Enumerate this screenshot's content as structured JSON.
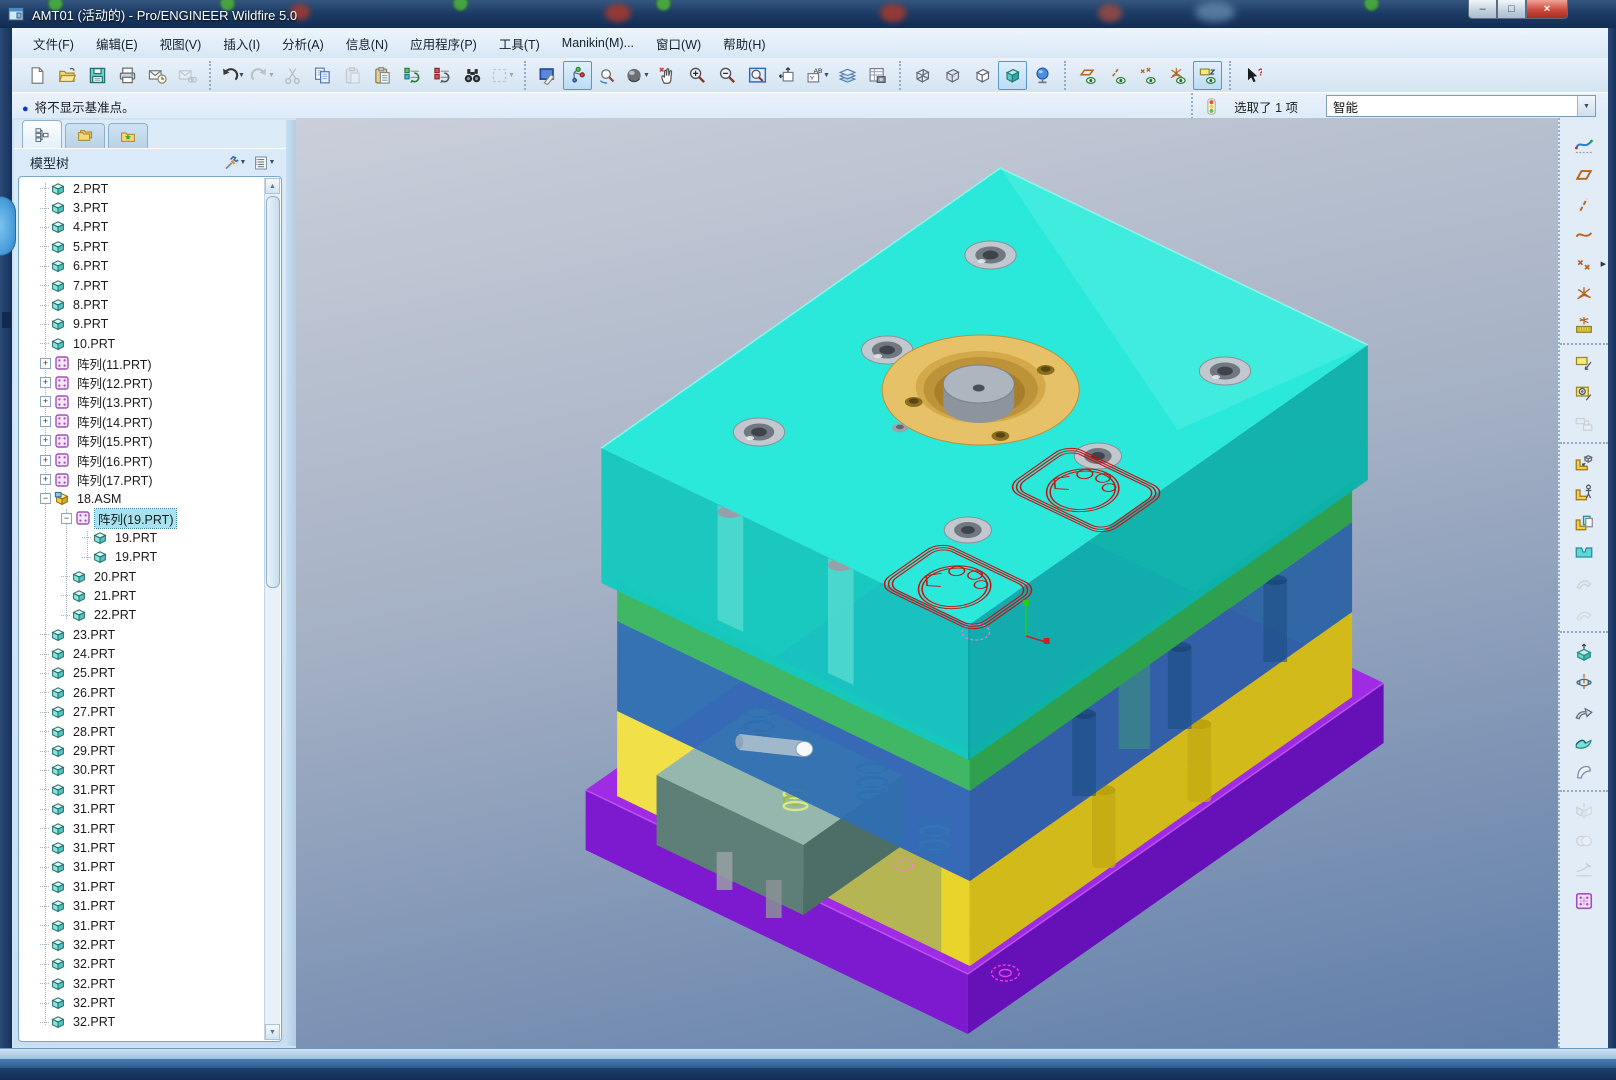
{
  "window": {
    "title": "AMT01 (活动的) - Pro/ENGINEER Wildfire 5.0",
    "controls": [
      {
        "name": "minimize",
        "glyph": "–"
      },
      {
        "name": "maximize",
        "glyph": "□"
      },
      {
        "name": "close",
        "glyph": "×"
      }
    ]
  },
  "menu_bar": {
    "items": [
      "文件(F)",
      "编辑(E)",
      "视图(V)",
      "插入(I)",
      "分析(A)",
      "信息(N)",
      "应用程序(P)",
      "工具(T)",
      "Manikin(M)...",
      "窗口(W)",
      "帮助(H)"
    ]
  },
  "toolbar": {
    "groups": [
      {
        "items": [
          {
            "icon": "new-file"
          },
          {
            "icon": "open-file"
          },
          {
            "icon": "save-file"
          },
          {
            "icon": "print"
          },
          {
            "icon": "send-mail"
          },
          {
            "icon": "mail-links",
            "disabled": true
          }
        ]
      },
      {
        "items": [
          {
            "icon": "undo",
            "dropdown": true
          },
          {
            "icon": "redo",
            "disabled": true,
            "dropdown": true
          },
          {
            "icon": "cut",
            "disabled": true
          },
          {
            "icon": "copy"
          },
          {
            "icon": "paste",
            "disabled": true
          },
          {
            "icon": "paste-special"
          },
          {
            "icon": "regenerate"
          },
          {
            "icon": "regenerate-manager"
          },
          {
            "icon": "find"
          },
          {
            "icon": "select-rect",
            "disabled": true,
            "dropdown": true
          }
        ]
      },
      {
        "items": [
          {
            "icon": "repaint"
          },
          {
            "icon": "spin-center",
            "pressed": true
          },
          {
            "icon": "orient-mode"
          },
          {
            "icon": "render-style",
            "dropdown": true
          },
          {
            "icon": "pan-zoom"
          },
          {
            "icon": "zoom-in"
          },
          {
            "icon": "zoom-out"
          },
          {
            "icon": "refit"
          },
          {
            "icon": "reorient-view"
          },
          {
            "icon": "saved-views",
            "dropdown": true
          },
          {
            "icon": "layers"
          },
          {
            "icon": "view-manager"
          }
        ]
      },
      {
        "items": [
          {
            "icon": "wireframe"
          },
          {
            "icon": "hidden-line"
          },
          {
            "icon": "no-hidden"
          },
          {
            "icon": "shaded",
            "pressed": true
          },
          {
            "icon": "spin-ball"
          }
        ]
      },
      {
        "items": [
          {
            "icon": "datum-plane-toggle"
          },
          {
            "icon": "datum-axis-toggle"
          },
          {
            "icon": "datum-point-toggle"
          },
          {
            "icon": "datum-csys-toggle"
          },
          {
            "icon": "annotation-toggle",
            "pressed": true
          }
        ]
      },
      {
        "items": [
          {
            "icon": "context-help"
          }
        ]
      }
    ]
  },
  "message_bar": {
    "bullet": "●",
    "message": "将不显示基准点。",
    "selection_status": "选取了 1 项",
    "filter_value": "智能"
  },
  "navigator": {
    "title": "模型树",
    "tabs": [
      {
        "icon": "tab-model-tree",
        "active": true
      },
      {
        "icon": "tab-folders",
        "active": false
      },
      {
        "icon": "tab-favorites",
        "active": false
      }
    ],
    "tools": [
      {
        "icon": "tree-settings",
        "dropdown": true
      },
      {
        "icon": "tree-columns",
        "dropdown": true
      }
    ]
  },
  "model_tree": {
    "items": [
      {
        "label": "2.PRT",
        "icon": "part",
        "level": 1
      },
      {
        "label": "3.PRT",
        "icon": "part",
        "level": 1
      },
      {
        "label": "4.PRT",
        "icon": "part",
        "level": 1
      },
      {
        "label": "5.PRT",
        "icon": "part",
        "level": 1
      },
      {
        "label": "6.PRT",
        "icon": "part",
        "level": 1
      },
      {
        "label": "7.PRT",
        "icon": "part",
        "level": 1
      },
      {
        "label": "8.PRT",
        "icon": "part",
        "level": 1
      },
      {
        "label": "9.PRT",
        "icon": "part",
        "level": 1
      },
      {
        "label": "10.PRT",
        "icon": "part",
        "level": 1
      },
      {
        "label": "阵列(11.PRT)",
        "icon": "pattern",
        "level": 1,
        "exp": "plus"
      },
      {
        "label": "阵列(12.PRT)",
        "icon": "pattern",
        "level": 1,
        "exp": "plus"
      },
      {
        "label": "阵列(13.PRT)",
        "icon": "pattern",
        "level": 1,
        "exp": "plus"
      },
      {
        "label": "阵列(14.PRT)",
        "icon": "pattern",
        "level": 1,
        "exp": "plus"
      },
      {
        "label": "阵列(15.PRT)",
        "icon": "pattern",
        "level": 1,
        "exp": "plus"
      },
      {
        "label": "阵列(16.PRT)",
        "icon": "pattern",
        "level": 1,
        "exp": "plus"
      },
      {
        "label": "阵列(17.PRT)",
        "icon": "pattern",
        "level": 1,
        "exp": "plus"
      },
      {
        "label": "18.ASM",
        "icon": "asm",
        "level": 1,
        "exp": "minus"
      },
      {
        "label": "阵列(19.PRT)",
        "icon": "pattern",
        "level": 2,
        "exp": "minus",
        "sel": true
      },
      {
        "label": "19.PRT",
        "icon": "part",
        "level": 3
      },
      {
        "label": "19.PRT",
        "icon": "part",
        "level": 3
      },
      {
        "label": "20.PRT",
        "icon": "part",
        "level": 2
      },
      {
        "label": "21.PRT",
        "icon": "part",
        "level": 2
      },
      {
        "label": "22.PRT",
        "icon": "part",
        "level": 2
      },
      {
        "label": "23.PRT",
        "icon": "part",
        "level": 1
      },
      {
        "label": "24.PRT",
        "icon": "part",
        "level": 1
      },
      {
        "label": "25.PRT",
        "icon": "part",
        "level": 1
      },
      {
        "label": "26.PRT",
        "icon": "part",
        "level": 1
      },
      {
        "label": "27.PRT",
        "icon": "part",
        "level": 1
      },
      {
        "label": "28.PRT",
        "icon": "part",
        "level": 1
      },
      {
        "label": "29.PRT",
        "icon": "part",
        "level": 1
      },
      {
        "label": "30.PRT",
        "icon": "part",
        "level": 1
      },
      {
        "label": "31.PRT",
        "icon": "part",
        "level": 1
      },
      {
        "label": "31.PRT",
        "icon": "part",
        "level": 1
      },
      {
        "label": "31.PRT",
        "icon": "part",
        "level": 1
      },
      {
        "label": "31.PRT",
        "icon": "part",
        "level": 1
      },
      {
        "label": "31.PRT",
        "icon": "part",
        "level": 1
      },
      {
        "label": "31.PRT",
        "icon": "part",
        "level": 1
      },
      {
        "label": "31.PRT",
        "icon": "part",
        "level": 1
      },
      {
        "label": "31.PRT",
        "icon": "part",
        "level": 1
      },
      {
        "label": "32.PRT",
        "icon": "part",
        "level": 1
      },
      {
        "label": "32.PRT",
        "icon": "part",
        "level": 1
      },
      {
        "label": "32.PRT",
        "icon": "part",
        "level": 1
      },
      {
        "label": "32.PRT",
        "icon": "part",
        "level": 1
      },
      {
        "label": "32.PRT",
        "icon": "part",
        "level": 1
      }
    ]
  },
  "right_toolbar": {
    "groups": [
      {
        "items": [
          {
            "icon": "style-tool"
          },
          {
            "icon": "datum-plane"
          },
          {
            "icon": "datum-axis"
          },
          {
            "icon": "datum-curve"
          },
          {
            "icon": "datum-point",
            "flyout": true
          },
          {
            "icon": "datum-csys"
          },
          {
            "icon": "sketch-tool"
          }
        ]
      },
      {
        "items": [
          {
            "icon": "annotation"
          },
          {
            "icon": "annotation-feature"
          },
          {
            "icon": "note",
            "disabled": true
          }
        ]
      },
      {
        "items": [
          {
            "icon": "assemble"
          },
          {
            "icon": "assemble-manikin"
          },
          {
            "icon": "create-component"
          },
          {
            "icon": "mold-feature"
          },
          {
            "icon": "flex-move",
            "disabled": true
          },
          {
            "icon": "flex-offset",
            "disabled": true
          }
        ]
      },
      {
        "items": [
          {
            "icon": "extrude"
          },
          {
            "icon": "revolve"
          },
          {
            "icon": "sweep"
          },
          {
            "icon": "boundary-blend"
          },
          {
            "icon": "style-surface"
          }
        ]
      },
      {
        "items": [
          {
            "icon": "mirror",
            "disabled": true
          },
          {
            "icon": "merge",
            "disabled": true
          },
          {
            "icon": "trim",
            "disabled": true
          },
          {
            "icon": "pattern"
          }
        ]
      }
    ]
  },
  "viewport": {
    "colors": {
      "top_plate_top": "#2BE9DA",
      "top_plate_left": "#14C9BE",
      "top_plate_right": "#0CB2AC",
      "green_left": "#3FB764",
      "green_right": "#2FA14E",
      "blue_left": "#2F6FB2",
      "blue_right": "#2A63A4",
      "yellow_left": "#E9D42C",
      "yellow_right": "#D3BA1B",
      "purple_top": "#A02BE4",
      "purple_left": "#7D1ACF",
      "purple_right": "#6610B8",
      "ring_gold": "#E7C167",
      "sketch_red": "#C61212",
      "sketch_magenta": "#F23AE2",
      "bg_top": "#CACFDA",
      "bg_bottom": "#5F7DA9"
    }
  }
}
